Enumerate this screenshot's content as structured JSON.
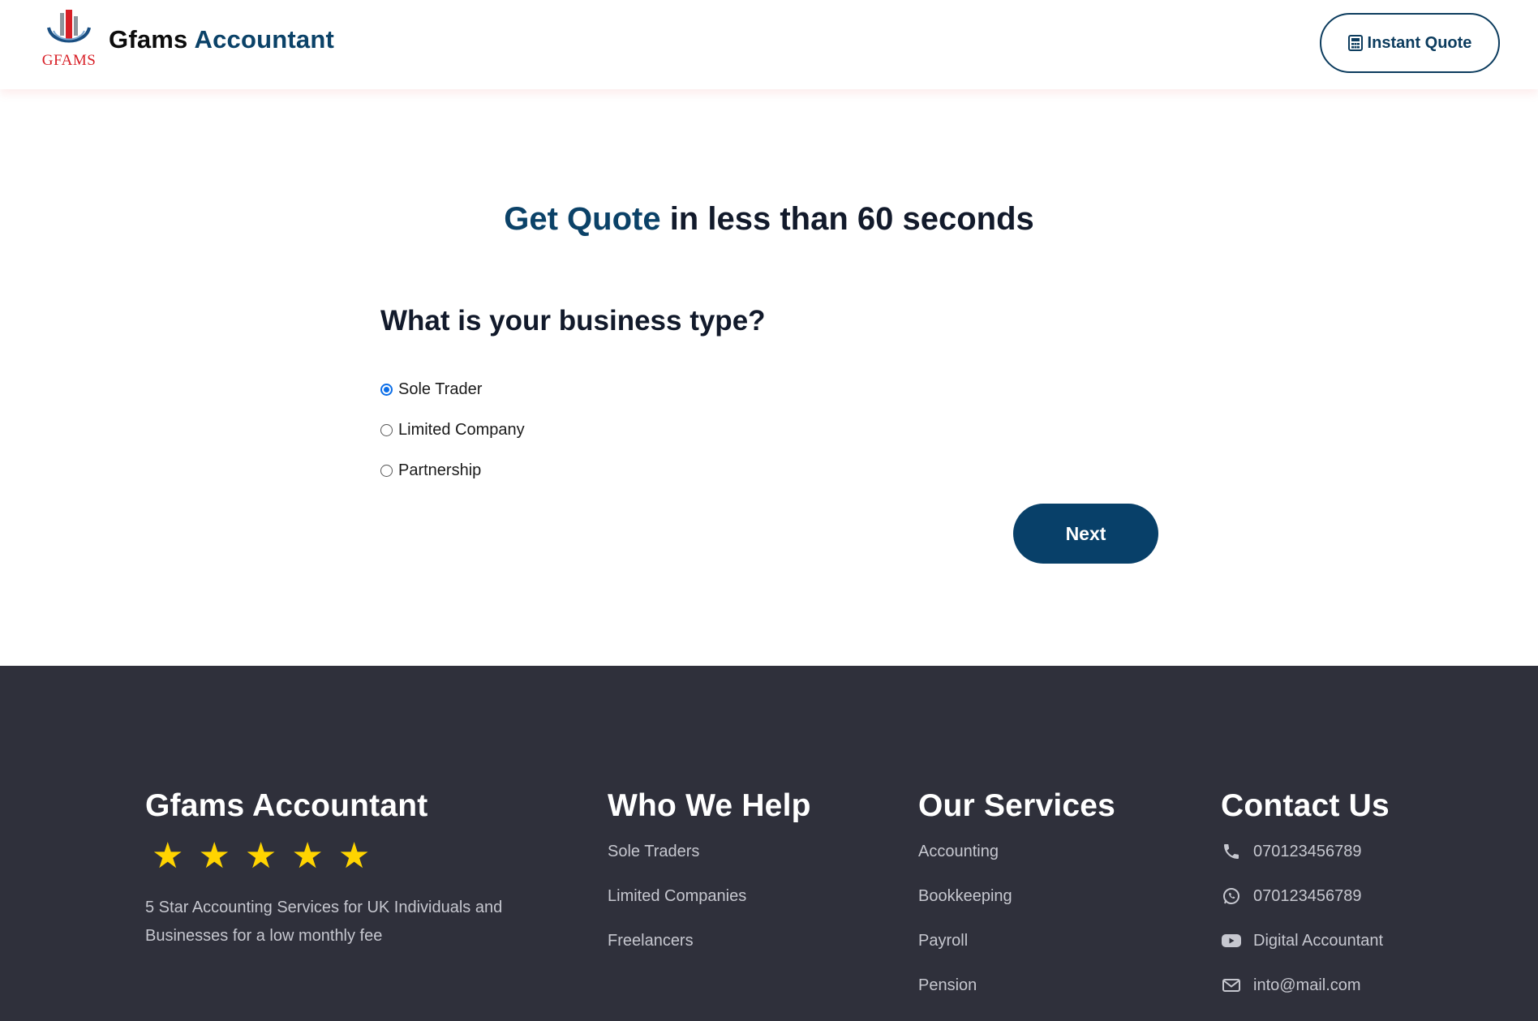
{
  "header": {
    "logo_text": "GFAMS",
    "brand_primary": "Gfams",
    "brand_secondary": "Accountant",
    "quote_button": "Instant Quote"
  },
  "hero": {
    "title_accent": "Get Quote",
    "title_rest": " in less than 60 seconds"
  },
  "form": {
    "question": "What is your business type?",
    "options": [
      {
        "label": "Sole Trader",
        "selected": true
      },
      {
        "label": "Limited Company",
        "selected": false
      },
      {
        "label": "Partnership",
        "selected": false
      }
    ],
    "next_label": "Next"
  },
  "footer": {
    "about": {
      "title": "Gfams Accountant",
      "rating": 5,
      "description": "5 Star Accounting Services for UK Individuals and Businesses for a low monthly fee"
    },
    "who_we_help": {
      "title": "Who We Help",
      "items": [
        "Sole Traders",
        "Limited Companies",
        "Freelancers"
      ]
    },
    "services": {
      "title": "Our Services",
      "items": [
        "Accounting",
        "Bookkeeping",
        "Payroll",
        "Pension"
      ]
    },
    "contact": {
      "title": "Contact Us",
      "items": [
        {
          "icon": "phone-icon",
          "text": "070123456789"
        },
        {
          "icon": "whatsapp-icon",
          "text": "070123456789"
        },
        {
          "icon": "youtube-icon",
          "text": "Digital Accountant"
        },
        {
          "icon": "mail-icon",
          "text": "into@mail.com"
        }
      ]
    }
  },
  "colors": {
    "brand_blue": "#0b4268",
    "button_blue": "#084069",
    "footer_bg": "#2f303b",
    "star": "#ffd400",
    "logo_red": "#d81f26"
  }
}
